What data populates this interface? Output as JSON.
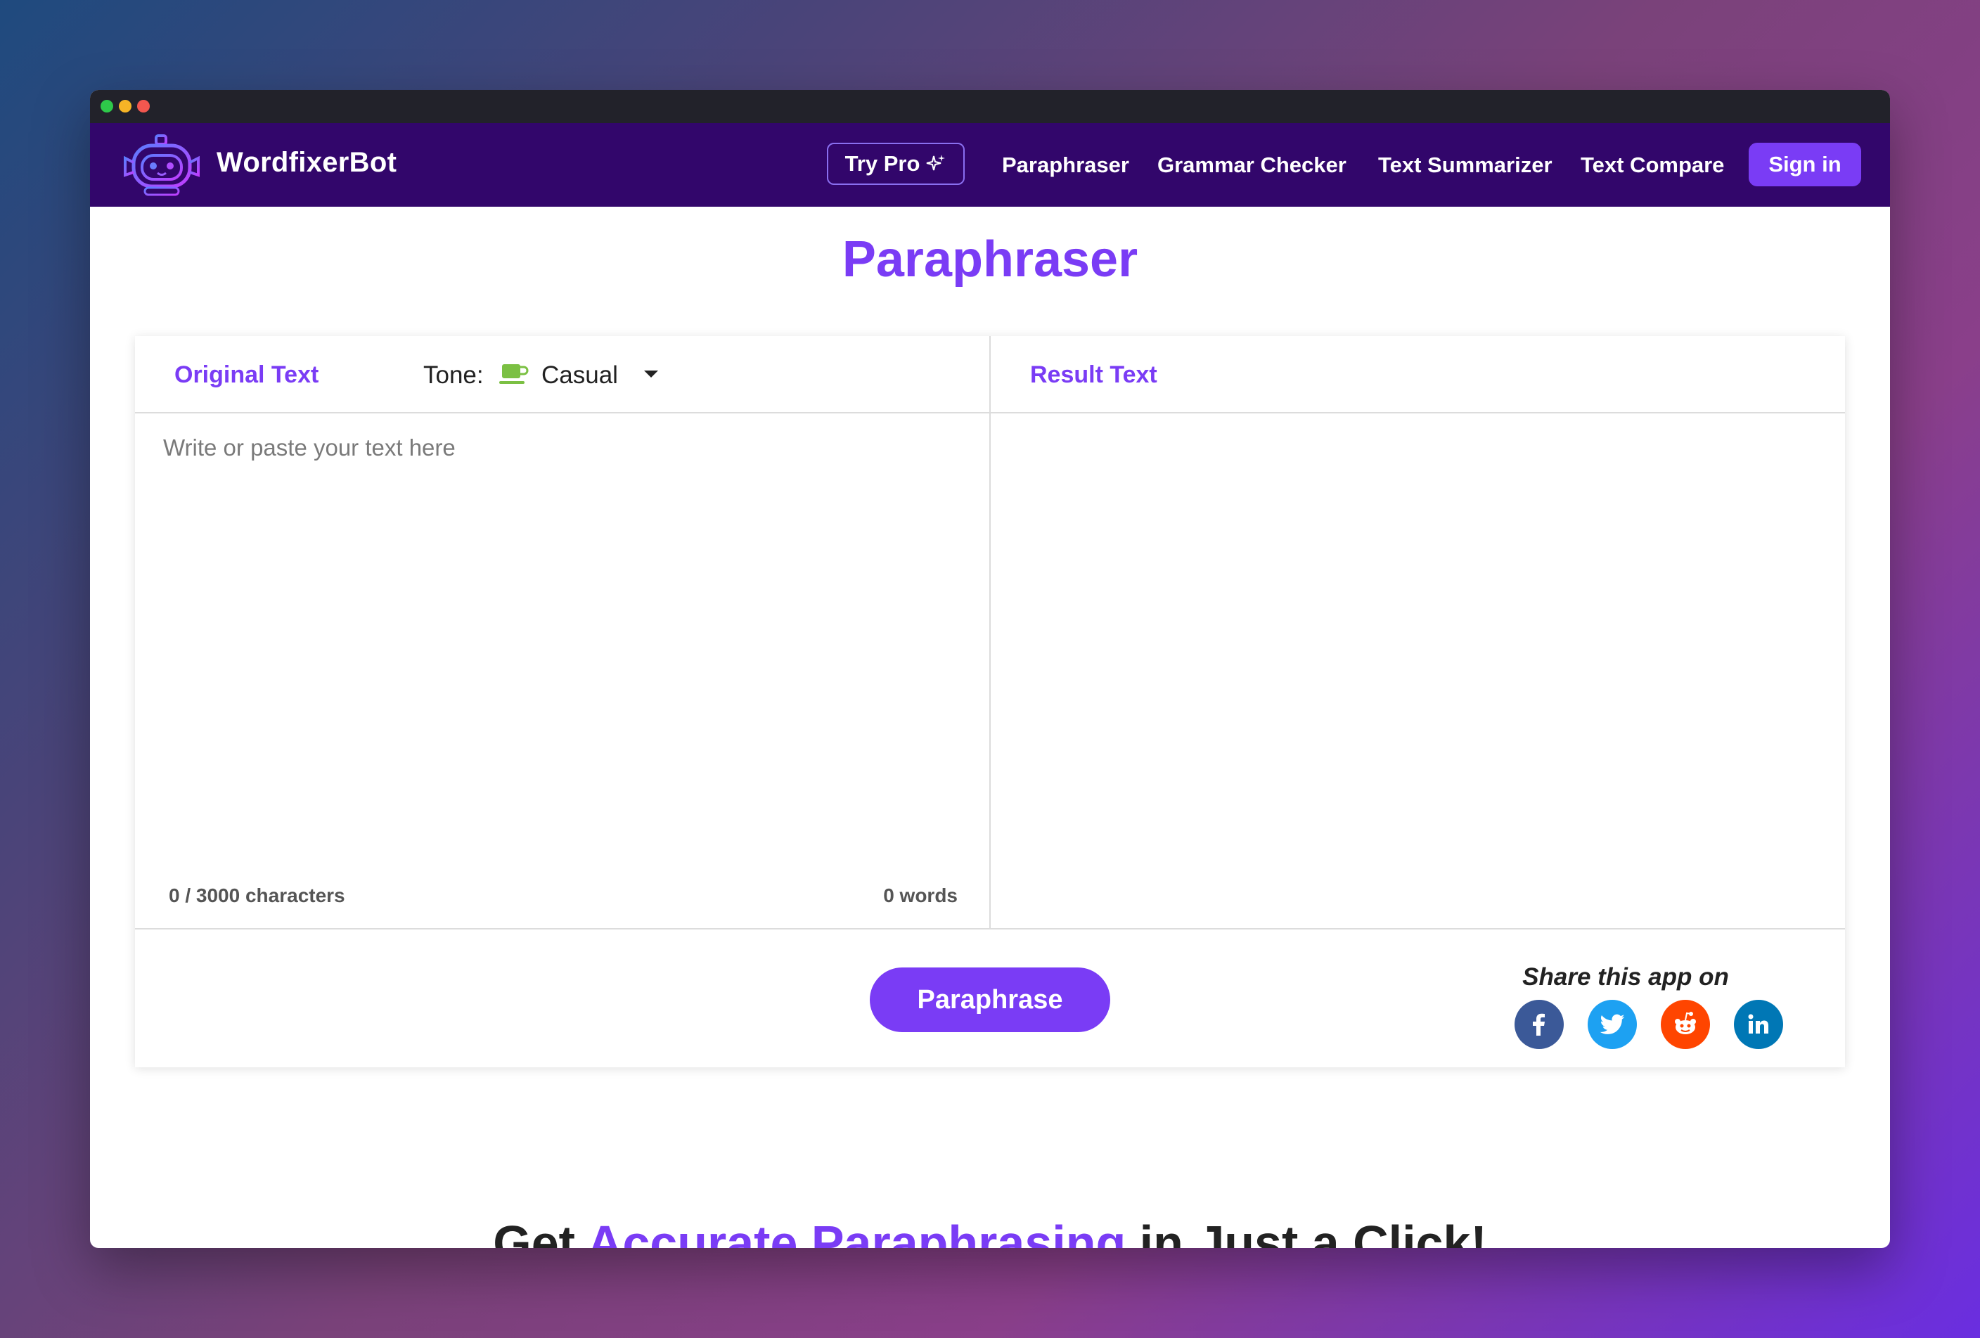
{
  "brand": {
    "name": "WordfixerBot",
    "logo": "robot-logo-icon"
  },
  "nav": {
    "try_pro": "Try Pro",
    "links": [
      "Paraphraser",
      "Grammar Checker",
      "Text Summarizer",
      "Text Compare"
    ],
    "sign_in": "Sign in"
  },
  "page_title": "Paraphraser",
  "editor": {
    "original_title": "Original Text",
    "tone_label": "Tone:",
    "tone_value": "Casual",
    "tone_icon": "coffee-cup-icon",
    "placeholder": "Write or paste your text here",
    "char_count": "0 / 3000 characters",
    "word_count": "0 words",
    "result_title": "Result Text"
  },
  "action": {
    "paraphrase": "Paraphrase"
  },
  "share": {
    "label": "Share this app on",
    "networks": [
      {
        "name": "facebook",
        "icon": "facebook-icon",
        "color": "#3b5998"
      },
      {
        "name": "twitter",
        "icon": "twitter-icon",
        "color": "#1da1f2"
      },
      {
        "name": "reddit",
        "icon": "reddit-icon",
        "color": "#ff4500"
      },
      {
        "name": "linkedin",
        "icon": "linkedin-icon",
        "color": "#0077b5"
      }
    ]
  },
  "bottom_heading": {
    "prefix": "Get ",
    "accent": "Accurate Paraphrasing",
    "suffix": " in Just a Click!"
  },
  "colors": {
    "accent": "#7a3cf5",
    "navbar": "#32066b",
    "titlebar": "#22222a"
  }
}
